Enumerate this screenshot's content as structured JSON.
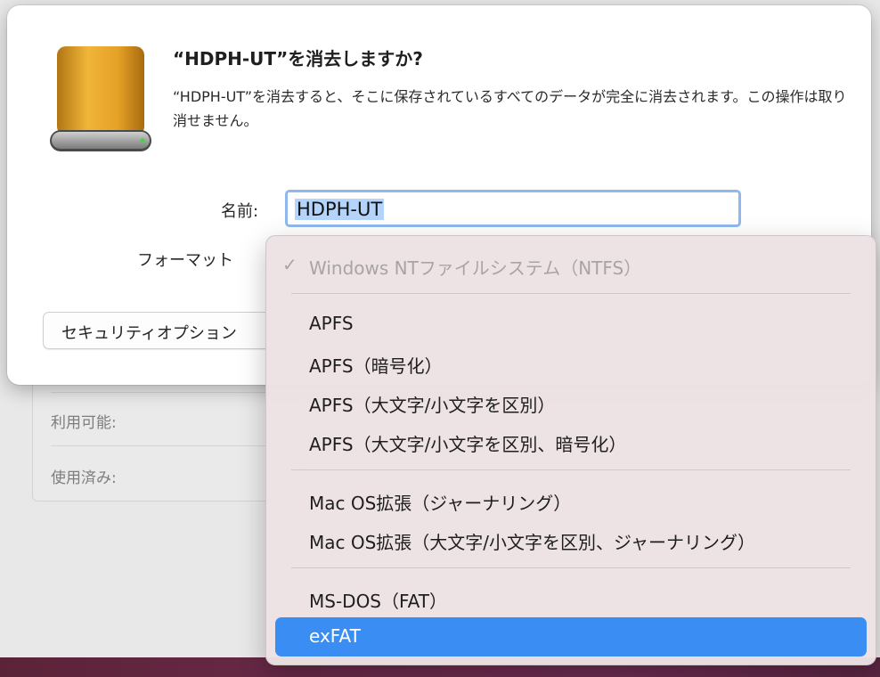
{
  "dialog": {
    "title": "“HDPH-UT”を消去しますか?",
    "message": "“HDPH-UT”を消去すると、そこに保存されているすべてのデータが完全に消去されます。この操作は取り消せません。",
    "name_label": "名前:",
    "name_value": "HDPH-UT",
    "format_label": "フォーマット",
    "security_button": "セキュリティオプション"
  },
  "background": {
    "available_label": "利用可能:",
    "used_label": "使用済み:"
  },
  "format_menu": {
    "current": "Windows NTファイルシステム（NTFS）",
    "groups": [
      [
        "APFS",
        "APFS（暗号化）",
        "APFS（大文字/小文字を区別）",
        "APFS（大文字/小文字を区別、暗号化）"
      ],
      [
        "Mac OS拡張（ジャーナリング）",
        "Mac OS拡張（大文字/小文字を区別、ジャーナリング）"
      ],
      [
        "MS-DOS（FAT）",
        "exFAT"
      ]
    ],
    "highlighted": "exFAT"
  },
  "colors": {
    "accent": "#3a8ef3",
    "disk_gold": "#e2a21f"
  },
  "icons": [
    "external-disk-icon",
    "checkmark-icon"
  ]
}
